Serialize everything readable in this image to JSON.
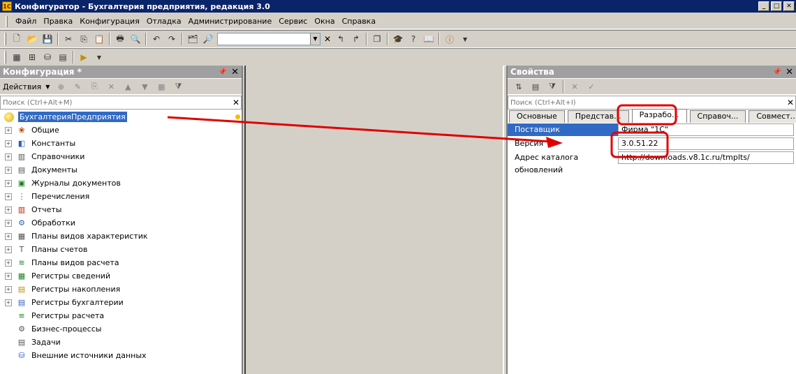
{
  "window": {
    "title": "Конфигуратор - Бухгалтерия предприятия, редакция 3.0",
    "buttons": [
      "_",
      "□",
      "✕"
    ]
  },
  "menu": [
    "Файл",
    "Правка",
    "Конфигурация",
    "Отладка",
    "Администрирование",
    "Сервис",
    "Окна",
    "Справка"
  ],
  "left_panel": {
    "title": "Конфигурация *",
    "actions_label": "Действия",
    "search_placeholder": "Поиск (Ctrl+Alt+M)",
    "root": "БухгалтерияПредприятия",
    "items": [
      {
        "label": "Общие",
        "icon": "общие-icon",
        "expandable": true
      },
      {
        "label": "Константы",
        "icon": "константы-icon",
        "expandable": true
      },
      {
        "label": "Справочники",
        "icon": "справочники-icon",
        "expandable": true
      },
      {
        "label": "Документы",
        "icon": "документы-icon",
        "expandable": true
      },
      {
        "label": "Журналы документов",
        "icon": "журналы-icon",
        "expandable": true
      },
      {
        "label": "Перечисления",
        "icon": "перечисления-icon",
        "expandable": true
      },
      {
        "label": "Отчеты",
        "icon": "отчеты-icon",
        "expandable": true
      },
      {
        "label": "Обработки",
        "icon": "обработки-icon",
        "expandable": true
      },
      {
        "label": "Планы видов характеристик",
        "icon": "пвх-icon",
        "expandable": true
      },
      {
        "label": "Планы счетов",
        "icon": "планы-счетов-icon",
        "expandable": true
      },
      {
        "label": "Планы видов расчета",
        "icon": "пвр-icon",
        "expandable": true
      },
      {
        "label": "Регистры сведений",
        "icon": "регистры-сведений-icon",
        "expandable": true
      },
      {
        "label": "Регистры накопления",
        "icon": "регистры-накопления-icon",
        "expandable": true
      },
      {
        "label": "Регистры бухгалтерии",
        "icon": "регистры-бухгалтерии-icon",
        "expandable": true
      },
      {
        "label": "Регистры расчета",
        "icon": "регистры-расчета-icon",
        "expandable": false
      },
      {
        "label": "Бизнес-процессы",
        "icon": "бизнес-процессы-icon",
        "expandable": false
      },
      {
        "label": "Задачи",
        "icon": "задачи-icon",
        "expandable": false
      },
      {
        "label": "Внешние источники данных",
        "icon": "внешние-источники-icon",
        "expandable": false
      }
    ]
  },
  "right_panel": {
    "title": "Свойства",
    "search_placeholder": "Поиск (Ctrl+Alt+I)",
    "tabs": [
      "Основные",
      "Представ...",
      "Разрабо...",
      "Справоч...",
      "Совмест..."
    ],
    "active_tab": 2,
    "properties": [
      {
        "name": "Поставщик",
        "value": "Фирма \"1С\"",
        "selected": true
      },
      {
        "name": "Версия",
        "value": "3.0.51.22",
        "selected": false
      },
      {
        "name": "Адрес каталога обновлений",
        "value": "http://downloads.v8.1c.ru/tmplts/",
        "selected": false
      }
    ]
  },
  "annotation_color": "#e00000"
}
